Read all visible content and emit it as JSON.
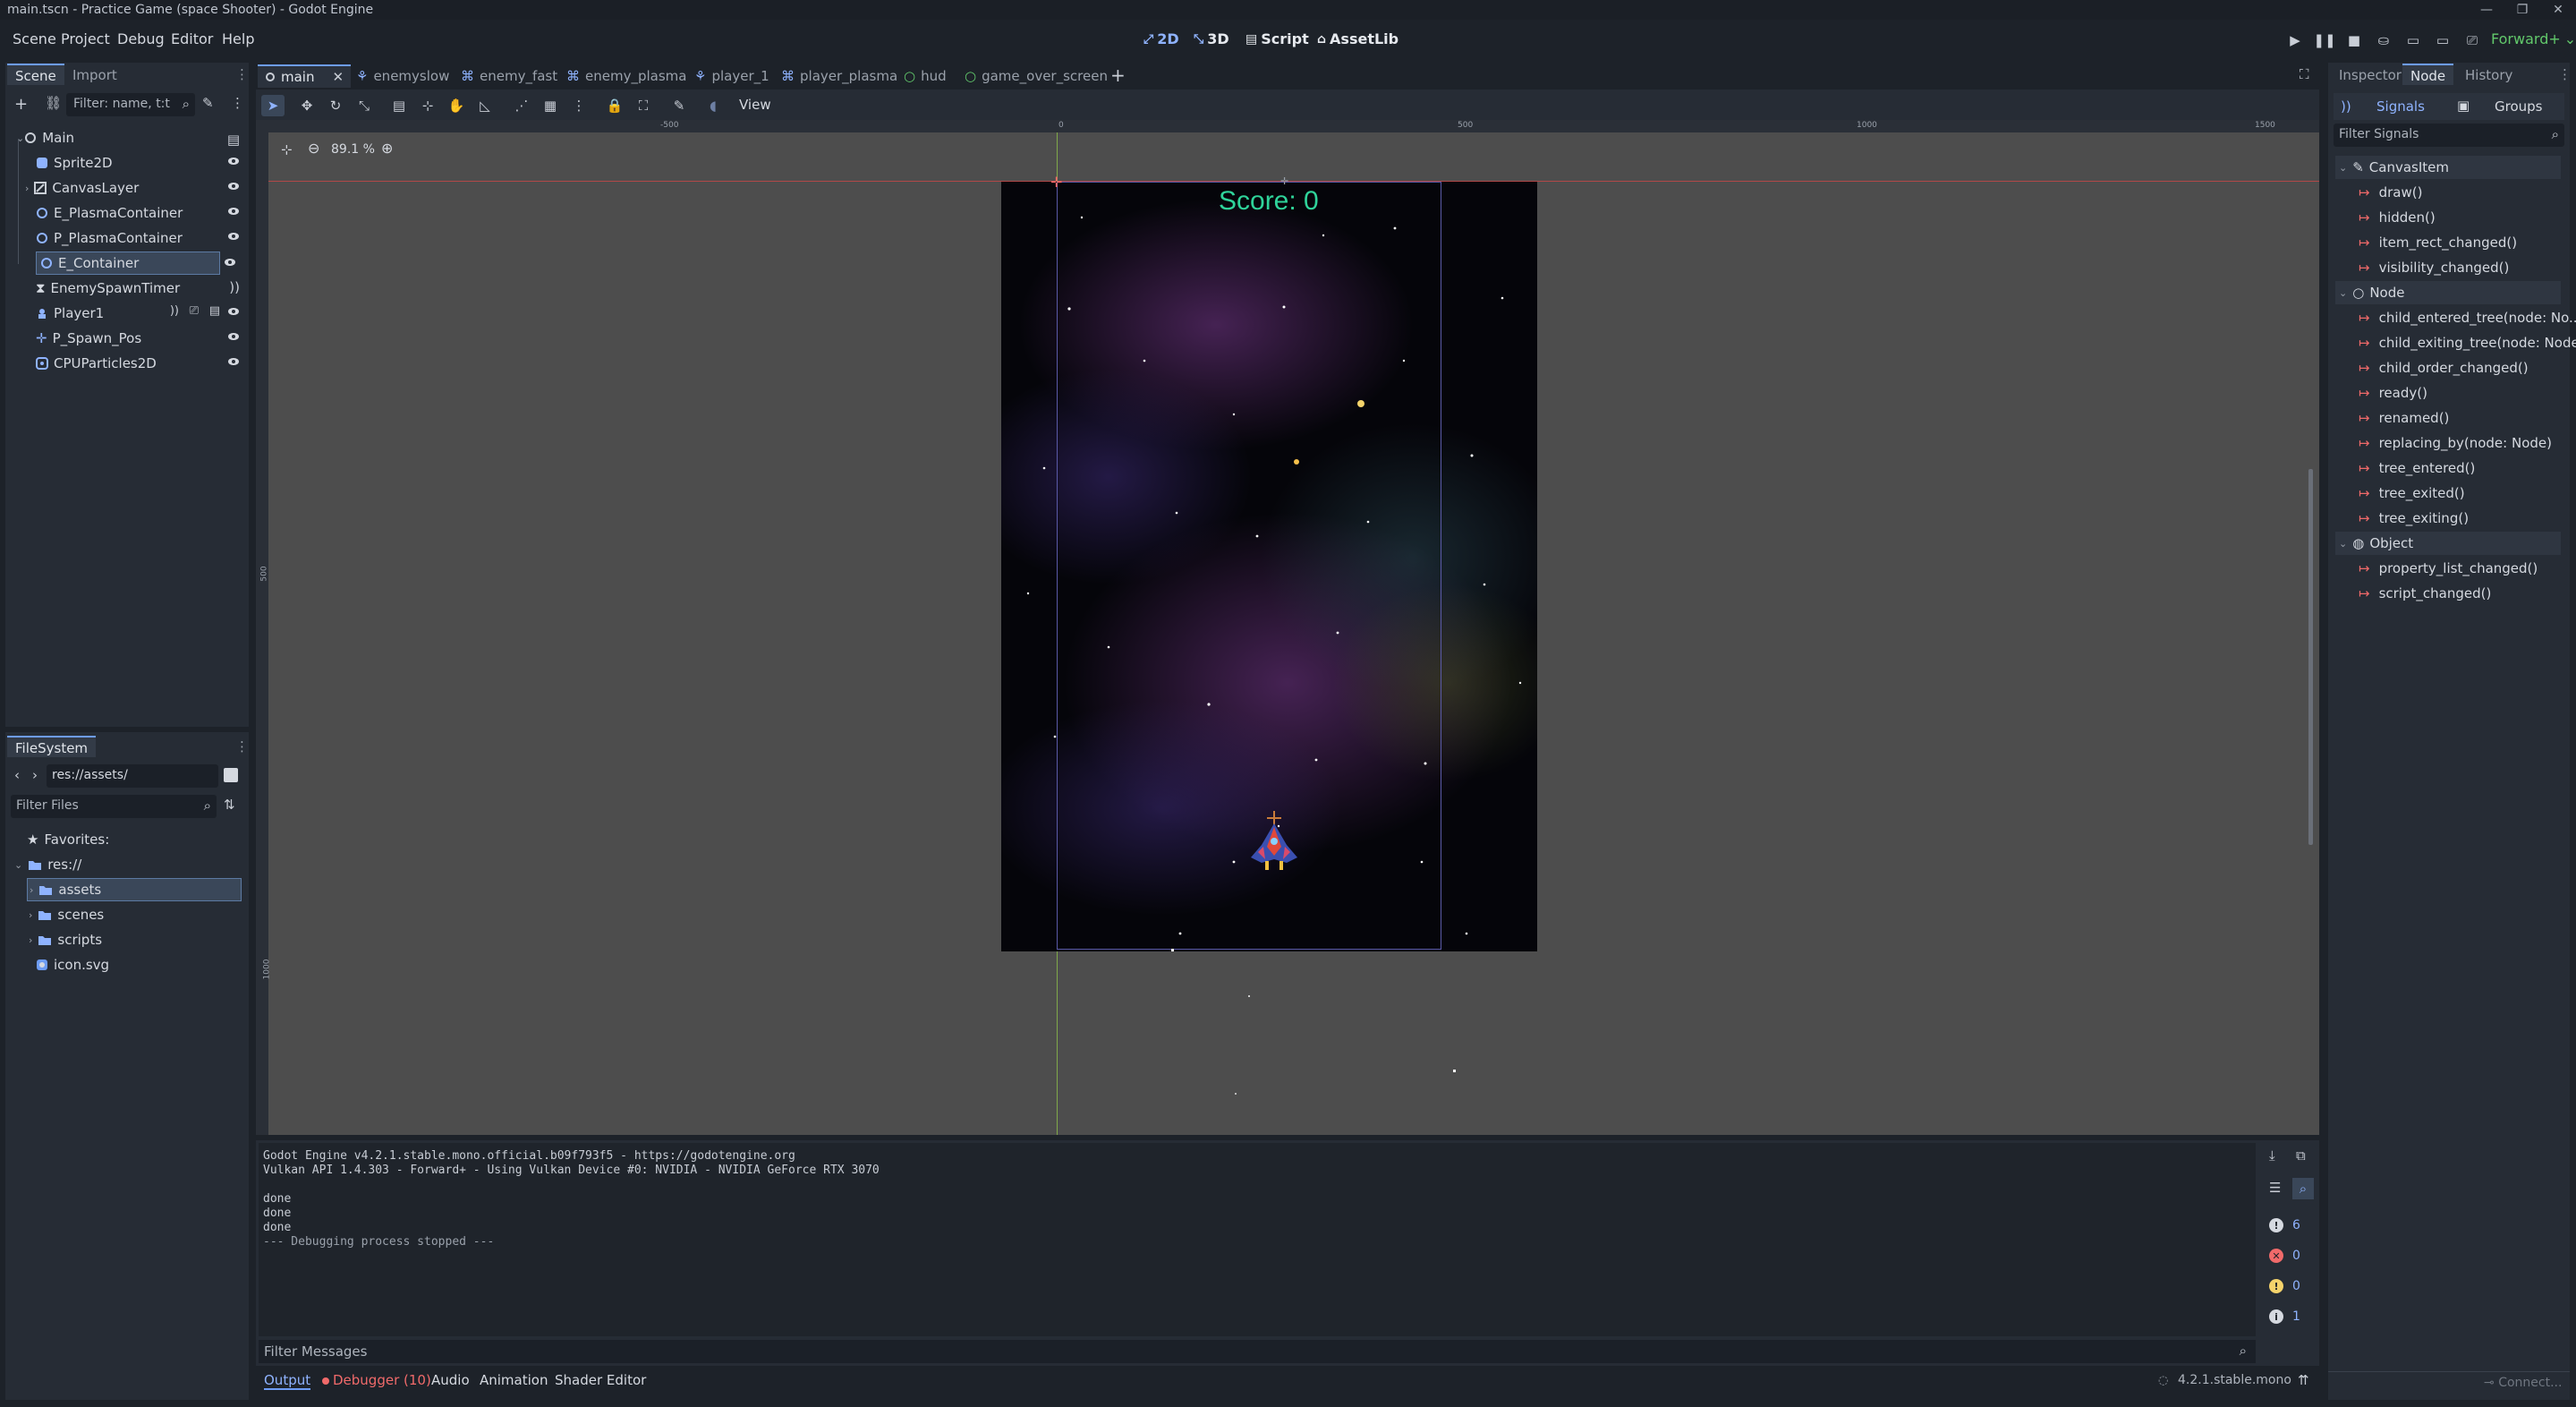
{
  "window": {
    "title": "main.tscn - Practice Game (space Shooter) - Godot Engine"
  },
  "menu": [
    "Scene",
    "Project",
    "Debug",
    "Editor",
    "Help"
  ],
  "workspaces": [
    "2D",
    "3D",
    "Script",
    "AssetLib"
  ],
  "renderer": "Forward+",
  "scene_dock": {
    "tabs": [
      "Scene",
      "Import"
    ],
    "filter_placeholder": "Filter: name, t:t",
    "nodes": [
      {
        "name": "Main",
        "icon": "node2d-icon"
      },
      {
        "name": "Sprite2D",
        "icon": "sprite2d-icon"
      },
      {
        "name": "CanvasLayer",
        "icon": "canvaslayer-icon"
      },
      {
        "name": "E_PlasmaContainer",
        "icon": "node2d-icon"
      },
      {
        "name": "P_PlasmaContainer",
        "icon": "node2d-icon"
      },
      {
        "name": "E_Container",
        "icon": "node2d-icon"
      },
      {
        "name": "EnemySpawnTimer",
        "icon": "timer-icon"
      },
      {
        "name": "Player1",
        "icon": "characterbody2d-icon"
      },
      {
        "name": "P_Spawn_Pos",
        "icon": "marker2d-icon"
      },
      {
        "name": "CPUParticles2D",
        "icon": "particles-icon"
      }
    ]
  },
  "filesystem": {
    "title": "FileSystem",
    "path": "res://assets/",
    "filter_placeholder": "Filter Files",
    "favorites": "Favorites:",
    "root": "res://",
    "items": [
      "assets",
      "scenes",
      "scripts",
      "icon.svg"
    ]
  },
  "scene_tabs": [
    "main",
    "enemyslow",
    "enemy_fast",
    "enemy_plasma",
    "player_1",
    "player_plasma",
    "hud",
    "game_over_screen"
  ],
  "viewport": {
    "view_label": "View",
    "zoom": "89.1 %",
    "ruler_top": [
      "-500",
      "0",
      "500",
      "1000",
      "1500"
    ],
    "ruler_left": [
      "500",
      "1000"
    ],
    "score_text": "Score: 0"
  },
  "output": {
    "lines": [
      "Godot Engine v4.2.1.stable.mono.official.b09f793f5 - https://godotengine.org",
      "Vulkan API 1.4.303 - Forward+ - Using Vulkan Device #0: NVIDIA - NVIDIA GeForce RTX 3070",
      "",
      "done",
      "done",
      "done",
      "--- Debugging process stopped ---"
    ],
    "filter_placeholder": "Filter Messages",
    "counts": {
      "messages": "6",
      "errors": "0",
      "warnings": "0",
      "info": "1"
    }
  },
  "bottom_tabs": [
    "Output",
    "Debugger (10)",
    "Audio",
    "Animation",
    "Shader Editor"
  ],
  "version": "4.2.1.stable.mono",
  "inspector": {
    "tabs": [
      "Inspector",
      "Node",
      "History"
    ],
    "subtabs": [
      "Signals",
      "Groups"
    ],
    "filter_placeholder": "Filter Signals",
    "groups": [
      {
        "name": "CanvasItem",
        "signals": [
          "draw()",
          "hidden()",
          "item_rect_changed()",
          "visibility_changed()"
        ]
      },
      {
        "name": "Node",
        "signals": [
          "child_entered_tree(node: No...",
          "child_exiting_tree(node: Node)",
          "child_order_changed()",
          "ready()",
          "renamed()",
          "replacing_by(node: Node)",
          "tree_entered()",
          "tree_exited()",
          "tree_exiting()"
        ]
      },
      {
        "name": "Object",
        "signals": [
          "property_list_changed()",
          "script_changed()"
        ]
      }
    ],
    "connect_label": "Connect..."
  },
  "colors": {
    "accent": "#6d9cf4",
    "score": "#2fd39a",
    "signal": "#f06a6a",
    "selection": "#3a4759"
  }
}
